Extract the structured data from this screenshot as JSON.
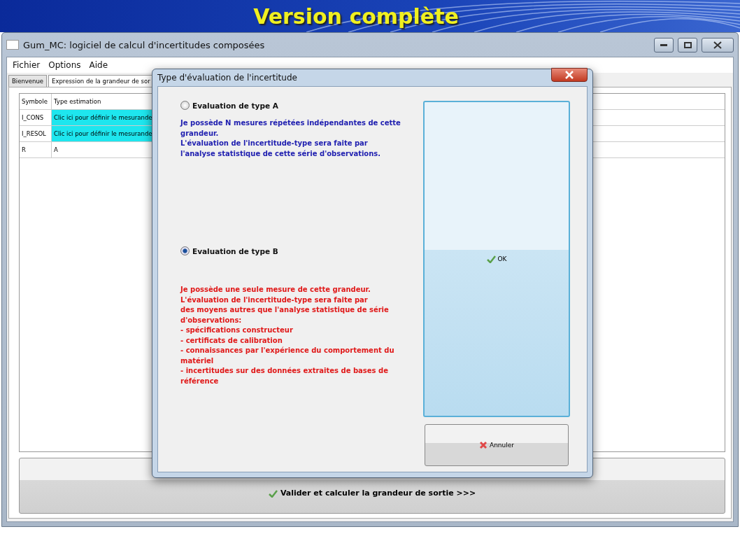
{
  "banner": {
    "title": "Version complète"
  },
  "window": {
    "title": "Gum_MC: logiciel de calcul d'incertitudes composées"
  },
  "menu": [
    "Fichier",
    "Options",
    "Aide"
  ],
  "tabs": [
    {
      "label": "Bienvenue",
      "selected": false
    },
    {
      "label": "Expression de la grandeur de sor",
      "selected": true
    }
  ],
  "table": {
    "columns": [
      "Symbole",
      "Type estimation"
    ],
    "rows": [
      {
        "symbol": "I_CONS",
        "type": "Clic ici pour définir le mesurande",
        "highlighted": true
      },
      {
        "symbol": "I_RESOL",
        "type": "Clic ici pour définir le mesurande",
        "highlighted": true
      },
      {
        "symbol": "R",
        "type": "A",
        "highlighted": false
      }
    ]
  },
  "validate_button": "Valider et calculer la grandeur de sortie >>>",
  "dialog": {
    "title": "Type d'évaluation de l'incertitude",
    "options": [
      {
        "label": "Evaluation de type A",
        "selected": false,
        "color": "#2020b0",
        "description": "Je possède N mesures répétées indépendantes de cette grandeur.\nL'évaluation de l'incertitude-type sera faite par\nl'analyse statistique de cette série d'observations."
      },
      {
        "label": "Evaluation de type B",
        "selected": true,
        "color": "#e01818",
        "description": "Je possède une seule mesure de cette grandeur.\nL'évaluation de l'incertitude-type sera faite par\ndes moyens autres que l'analyse statistique de série\nd'observations:\n- spécifications constructeur\n- certificats de calibration\n- connaissances par l'expérience du comportement du\nmatériel\n- incertitudes sur des données extraites de bases de\nréférence"
      }
    ],
    "ok_button": "OK",
    "cancel_button": "Annuler"
  }
}
